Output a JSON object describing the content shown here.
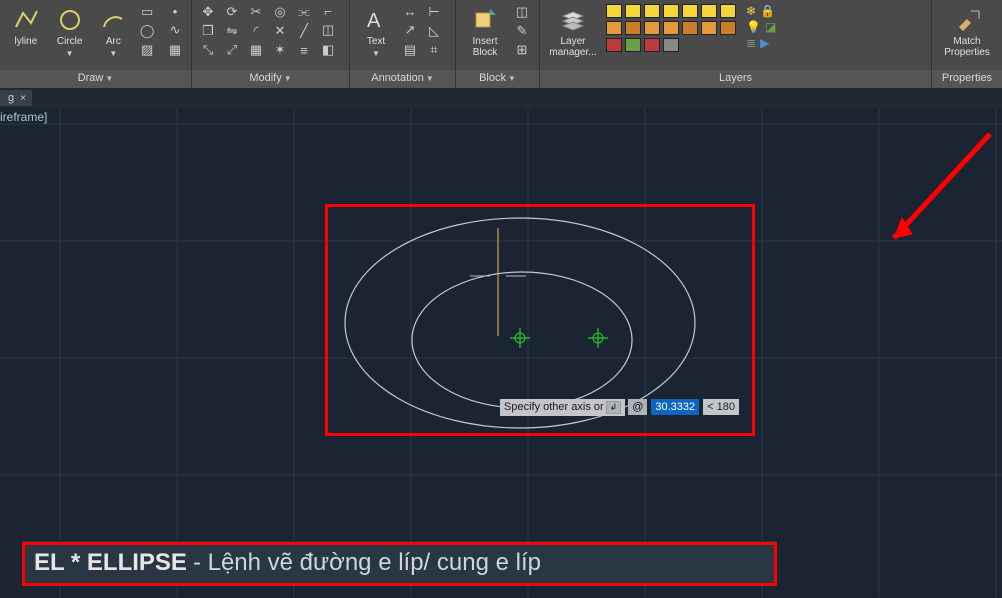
{
  "ribbon": {
    "groups": {
      "draw": {
        "label": "Draw"
      },
      "modify": {
        "label": "Modify"
      },
      "annotation": {
        "label": "Annotation"
      },
      "block": {
        "label": "Block"
      },
      "layers": {
        "label": "Layers"
      },
      "properties": {
        "label": "Properties"
      }
    },
    "buttons": {
      "polyline": "lyline",
      "circle": "Circle",
      "arc": "Arc",
      "text": "Text",
      "insert_block": "Insert\nBlock",
      "layer_mgr": "Layer\nmanager...",
      "match_props": "Match\nProperties"
    }
  },
  "tab": {
    "label": "g",
    "close": "×"
  },
  "viewport": {
    "wire_label": "ireframe]"
  },
  "command_float": {
    "prompt": "Specify other axis or",
    "hint_icon": "↲",
    "at_symbol": "@",
    "value": "30.3332",
    "angle_prefix": "<",
    "angle": "180"
  },
  "caption": {
    "strong": "EL * ELLIPSE",
    "rest": " - Lệnh vẽ đường e líp/ cung e líp"
  }
}
